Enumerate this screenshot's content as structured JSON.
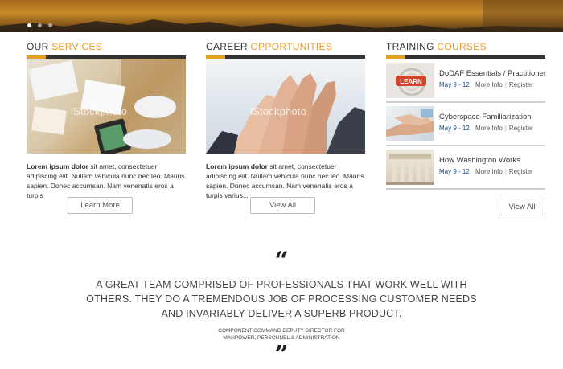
{
  "carousel": {
    "dots": 3,
    "active_index": 0
  },
  "services": {
    "title_plain": "OUR ",
    "title_accent": "SERVICES",
    "desc_bold": "Lorem ipsum dolor",
    "desc_rest": " sit amet, consectetuer adipiscing elit. Nullam vehicula nunc nec leo. Mauris sapien. Donec accumsan. Nam venenatis eros a turpis",
    "watermark": "iStockphoto",
    "button": "Learn More"
  },
  "careers": {
    "title_plain": "CAREER ",
    "title_accent": "OPPORTUNITIES",
    "desc_bold": "Lorem ipsum dolor",
    "desc_rest": " sit amet, consectetuer adipiscing elit. Nullam vehicula nunc nec leo. Mauris sapien. Donec accumsan. Nam venenatis eros a turpis varius...",
    "watermark": "iStockphoto",
    "button": "View All"
  },
  "training": {
    "title_plain": "TRAINING ",
    "title_accent": "COURSES",
    "courses": [
      {
        "title": "DoDAF Essentials / Practitioner",
        "date": "May 9 - 12",
        "more": "More Info",
        "register": "Register",
        "thumb_label": "LEARN"
      },
      {
        "title": "Cyberspace Familiarization",
        "date": "May 9 - 12",
        "more": "More Info",
        "register": "Register"
      },
      {
        "title": "How Washington Works",
        "date": "May 9 - 12",
        "more": "More Info",
        "register": "Register"
      }
    ],
    "button": "View All"
  },
  "testimonial": {
    "open_mark": "“",
    "close_mark": "”",
    "line1": "A GREAT TEAM COMPRISED OF PROFESSIONALS THAT WORK WELL WITH",
    "line2": "OTHERS. THEY DO A TREMENDOUS JOB OF PROCESSING CUSTOMER NEEDS",
    "line3": "AND INVARIABLY DELIVER A SUPERB PRODUCT.",
    "attribution1": "COMPONENT COMMAND DEPUTY DIRECTOR FOR",
    "attribution2": "MANPOWER, PERSONNEL & ADMINISTRATION"
  },
  "colors": {
    "accent": "#e8a020",
    "link_date": "#1a4e8a",
    "hero": "#c88a2a"
  }
}
